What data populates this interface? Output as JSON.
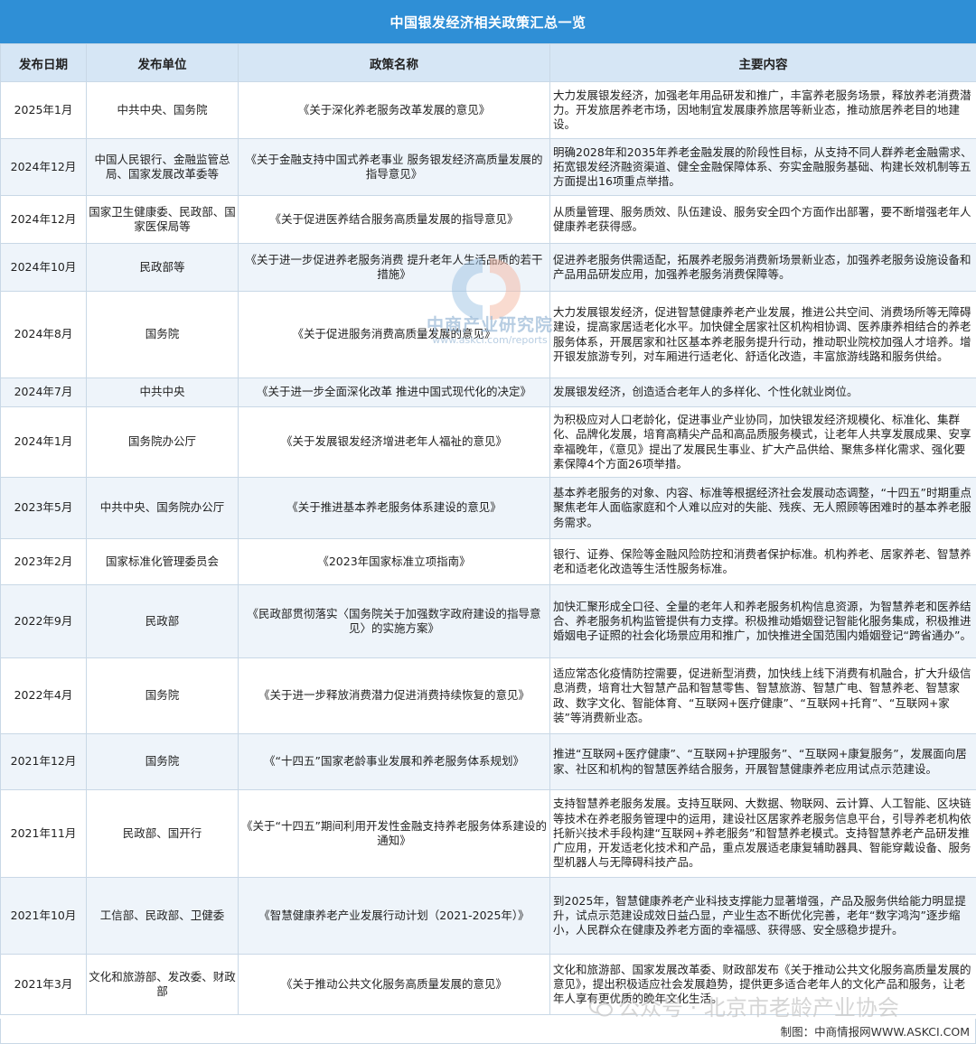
{
  "title": "中国银发经济相关政策汇总一览",
  "headers": {
    "date": "发布日期",
    "unit": "发布单位",
    "name": "政策名称",
    "content": "主要内容"
  },
  "rows": [
    {
      "date": "2025年1月",
      "unit": "中共中央、国务院",
      "name": "《关于深化养老服务改革发展的意见》",
      "content": "大力发展银发经济，加强老年用品研发和推广，丰富养老服务场景，释放养老消费潜力。开发旅居养老市场，因地制宜发展康养旅居等新业态，推动旅居养老目的地建设。"
    },
    {
      "date": "2024年12月",
      "unit": "中国人民银行、金融监管总局、国家发展改革委等",
      "name": "《关于金融支持中国式养老事业 服务银发经济高质量发展的指导意见》",
      "content": "明确2028年和2035年养老金融发展的阶段性目标，从支持不同人群养老金融需求、拓宽银发经济融资渠道、健全金融保障体系、夯实金融服务基础、构建长效机制等五方面提出16项重点举措。"
    },
    {
      "date": "2024年12月",
      "unit": "国家卫生健康委、民政部、国家医保局等",
      "name": "《关于促进医养结合服务高质量发展的指导意见》",
      "content": "从质量管理、服务质效、队伍建设、服务安全四个方面作出部署，要不断增强老年人健康养老获得感。"
    },
    {
      "date": "2024年10月",
      "unit": "民政部等",
      "name": "《关于进一步促进养老服务消费 提升老年人生活品质的若干措施》",
      "content": "促进养老服务供需适配，拓展养老服务消费新场景新业态，加强养老服务设施设备和产品用品研发应用，加强养老服务消费保障等。"
    },
    {
      "date": "2024年8月",
      "unit": "国务院",
      "name": "《关于促进服务消费高质量发展的意见》",
      "content": "大力发展银发经济，促进智慧健康养老产业发展，推进公共空间、消费场所等无障碍建设，提高家居适老化水平。加快健全居家社区机构相协调、医养康养相结合的养老服务体系，开展居家和社区基本养老服务提升行动，推动职业院校加强人才培养。增开银发旅游专列，对车厢进行适老化、舒适化改造，丰富旅游线路和服务供给。"
    },
    {
      "date": "2024年7月",
      "unit": "中共中央",
      "name": "《关于进一步全面深化改革 推进中国式现代化的决定》",
      "content": "发展银发经济，创造适合老年人的多样化、个性化就业岗位。"
    },
    {
      "date": "2024年1月",
      "unit": "国务院办公厅",
      "name": "《关于发展银发经济增进老年人福祉的意见》",
      "content": "为积极应对人口老龄化，促进事业产业协同，加快银发经济规模化、标准化、集群化、品牌化发展，培育高精尖产品和高品质服务模式，让老年人共享发展成果、安享幸福晚年，《意见》提出了发展民生事业、扩大产品供给、聚焦多样化需求、强化要素保障4个方面26项举措。"
    },
    {
      "date": "2023年5月",
      "unit": "中共中央、国务院办公厅",
      "name": "《关于推进基本养老服务体系建设的意见》",
      "content": "基本养老服务的对象、内容、标准等根据经济社会发展动态调整，“十四五”时期重点聚焦老年人面临家庭和个人难以应对的失能、残疾、无人照顾等困难时的基本养老服务需求。"
    },
    {
      "date": "2023年2月",
      "unit": "国家标准化管理委员会",
      "name": "《2023年国家标准立项指南》",
      "content": "银行、证券、保险等金融风险防控和消费者保护标准。机构养老、居家养老、智慧养老和适老化改造等生活性服务标准。"
    },
    {
      "date": "2022年9月",
      "unit": "民政部",
      "name": "《民政部贯彻落实〈国务院关于加强数字政府建设的指导意见〉的实施方案》",
      "content": "加快汇聚形成全口径、全量的老年人和养老服务机构信息资源，为智慧养老和医养结合、养老服务机构监管提供有力支撑。积极推动婚姻登记智能化服务集成，积极推进婚姻电子证照的社会化场景应用和推广，加快推进全国范围内婚姻登记“跨省通办”。"
    },
    {
      "date": "2022年4月",
      "unit": "国务院",
      "name": "《关于进一步释放消费潜力促进消费持续恢复的意见》",
      "content": "适应常态化疫情防控需要，促进新型消费，加快线上线下消费有机融合，扩大升级信息消费，培育壮大智慧产品和智慧零售、智慧旅游、智慧广电、智慧养老、智慧家政、数字文化、智能体育、“互联网+医疗健康”、“互联网+托育”、“互联网+家装”等消费新业态。"
    },
    {
      "date": "2021年12月",
      "unit": "国务院",
      "name": "《“十四五”国家老龄事业发展和养老服务体系规划》",
      "content": "推进“互联网+医疗健康”、“互联网+护理服务”、“互联网+康复服务”，发展面向居家、社区和机构的智慧医养结合服务，开展智慧健康养老应用试点示范建设。"
    },
    {
      "date": "2021年11月",
      "unit": "民政部、国开行",
      "name": "《关于“十四五”期间利用开发性金融支持养老服务体系建设的通知》",
      "content": "支持智慧养老服务发展。支持互联网、大数据、物联网、云计算、人工智能、区块链等技术在养老服务管理中的运用，建设社区居家养老服务信息平台，引导养老机构依托新兴技术手段构建“互联网+养老服务”和智慧养老模式。支持智慧养老产品研发推广应用，开发适老化技术和产品，重点发展适老康复辅助器具、智能穿戴设备、服务型机器人与无障碍科技产品。"
    },
    {
      "date": "2021年10月",
      "unit": "工信部、民政部、卫健委",
      "name": "《智慧健康养老产业发展行动计划（2021-2025年）》",
      "content": "到2025年，智慧健康养老产业科技支撑能力显著增强，产品及服务供给能力明显提升，试点示范建设成效日益凸显，产业生态不断优化完善，老年“数字鸿沟”逐步缩小，人民群众在健康及养老方面的幸福感、获得感、安全感稳步提升。"
    },
    {
      "date": "2021年3月",
      "unit": "文化和旅游部、发改委、财政部",
      "name": "《关于推动公共文化服务高质量发展的意见》",
      "content": "文化和旅游部、国家发展改革委、财政部发布《关于推动公共文化服务高质量发展的意见》，提出积极适应社会发展趋势，提供更多适合老年人的文化产品和服务，让老年人享有更优质的晚年文化生活。"
    }
  ],
  "footer": "制图：中商情报网WWW.ASKCI.COM",
  "watermark_center": {
    "name": "中商产业研究院",
    "url": "www.askci.com/reports"
  },
  "watermark_bottom": "公众号 · 北京市老龄产业协会"
}
